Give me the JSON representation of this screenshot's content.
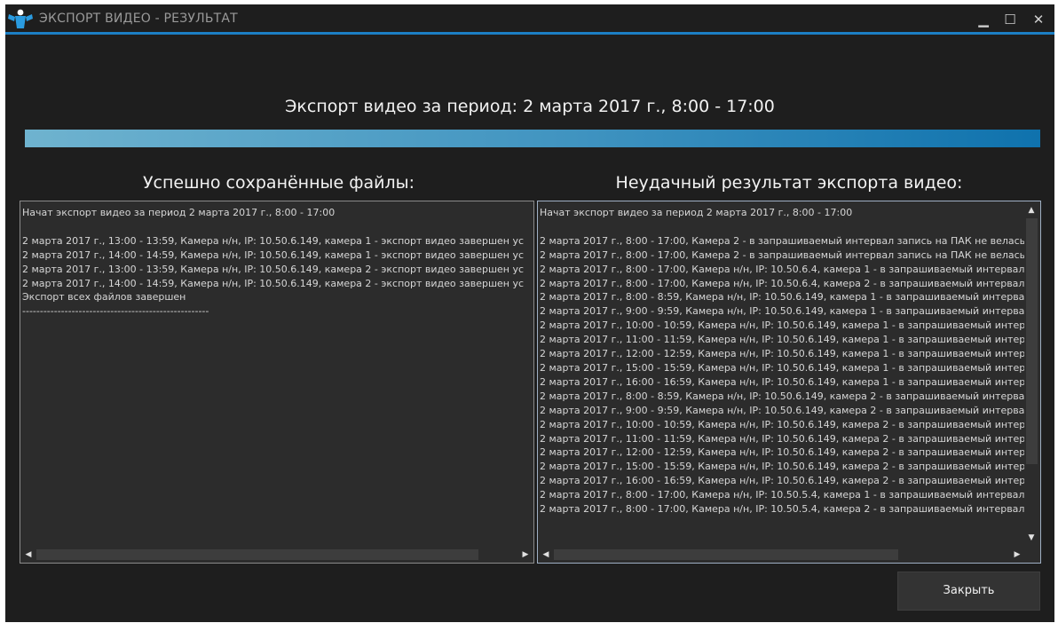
{
  "window": {
    "title": "ЭКСПОРТ ВИДЕО - РЕЗУЛЬТАТ",
    "minimize_glyph": "▁",
    "maximize_glyph": "☐",
    "close_glyph": "✕",
    "accent_color": "#1c7fc4"
  },
  "heading": "Экспорт видео за период: 2 марта 2017 г., 8:00 - 17:00",
  "progress": {
    "percent": 100
  },
  "success_panel": {
    "title": "Успешно сохранённые файлы:",
    "lines": [
      "Начат экспорт видео за период 2 марта 2017 г., 8:00 - 17:00",
      "",
      "2 марта 2017 г., 13:00 - 13:59, Камера н/н, IP: 10.50.6.149, камера 1 - экспорт видео завершен ус",
      "2 марта 2017 г., 14:00 - 14:59, Камера н/н, IP: 10.50.6.149, камера 1 - экспорт видео завершен ус",
      "2 марта 2017 г., 13:00 - 13:59, Камера н/н, IP: 10.50.6.149, камера 2 - экспорт видео завершен ус",
      "2 марта 2017 г., 14:00 - 14:59, Камера н/н, IP: 10.50.6.149, камера 2 - экспорт видео завершен ус",
      "Экспорт всех файлов завершен",
      "-----------------------------------------------------"
    ]
  },
  "failure_panel": {
    "title": "Неудачный результат экспорта видео:",
    "lines": [
      "Начат экспорт видео за период 2 марта 2017 г., 8:00 - 17:00",
      "",
      "2 марта 2017 г., 8:00 - 17:00, Камера 2 - в запрашиваемый интервал запись на ПАК не велась",
      "2 марта 2017 г., 8:00 - 17:00, Камера 2 - в запрашиваемый интервал запись на ПАК не велась",
      "2 марта 2017 г., 8:00 - 17:00, Камера н/н, IP: 10.50.6.4, камера 1 - в запрашиваемый интервал",
      "2 марта 2017 г., 8:00 - 17:00, Камера н/н, IP: 10.50.6.4, камера 2 - в запрашиваемый интервал",
      "2 марта 2017 г., 8:00 - 8:59, Камера н/н, IP: 10.50.6.149, камера 1 - в запрашиваемый интерва",
      "2 марта 2017 г., 9:00 - 9:59, Камера н/н, IP: 10.50.6.149, камера 1 - в запрашиваемый интерва",
      "2 марта 2017 г., 10:00 - 10:59, Камера н/н, IP: 10.50.6.149, камера 1 - в запрашиваемый интер",
      "2 марта 2017 г., 11:00 - 11:59, Камера н/н, IP: 10.50.6.149, камера 1 - в запрашиваемый интер",
      "2 марта 2017 г., 12:00 - 12:59, Камера н/н, IP: 10.50.6.149, камера 1 - в запрашиваемый интер",
      "2 марта 2017 г., 15:00 - 15:59, Камера н/н, IP: 10.50.6.149, камера 1 - в запрашиваемый интер",
      "2 марта 2017 г., 16:00 - 16:59, Камера н/н, IP: 10.50.6.149, камера 1 - в запрашиваемый интер",
      "2 марта 2017 г., 8:00 - 8:59, Камера н/н, IP: 10.50.6.149, камера 2 - в запрашиваемый интерва",
      "2 марта 2017 г., 9:00 - 9:59, Камера н/н, IP: 10.50.6.149, камера 2 - в запрашиваемый интерва",
      "2 марта 2017 г., 10:00 - 10:59, Камера н/н, IP: 10.50.6.149, камера 2 - в запрашиваемый интер",
      "2 марта 2017 г., 11:00 - 11:59, Камера н/н, IP: 10.50.6.149, камера 2 - в запрашиваемый интер",
      "2 марта 2017 г., 12:00 - 12:59, Камера н/н, IP: 10.50.6.149, камера 2 - в запрашиваемый интер",
      "2 марта 2017 г., 15:00 - 15:59, Камера н/н, IP: 10.50.6.149, камера 2 - в запрашиваемый интер",
      "2 марта 2017 г., 16:00 - 16:59, Камера н/н, IP: 10.50.6.149, камера 2 - в запрашиваемый интер",
      "2 марта 2017 г., 8:00 - 17:00, Камера н/н, IP: 10.50.5.4, камера 1 - в запрашиваемый интервал",
      "2 марта 2017 г., 8:00 - 17:00, Камера н/н, IP: 10.50.5.4, камера 2 - в запрашиваемый интервал"
    ]
  },
  "scroll": {
    "left_arrow": "◀",
    "right_arrow": "▶",
    "up_arrow": "▲",
    "down_arrow": "▼"
  },
  "close_button_label": "Закрыть"
}
